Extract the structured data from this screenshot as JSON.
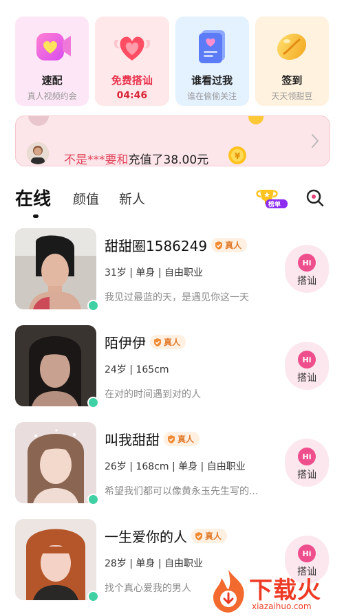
{
  "features": [
    {
      "title": "速配",
      "sub": "真人视频约会",
      "icon": "video-heart-icon"
    },
    {
      "title": "免费搭讪",
      "sub": "04:46",
      "icon": "winged-heart-icon"
    },
    {
      "title": "谁看过我",
      "sub": "谁在偷偷关注",
      "icon": "profile-card-icon"
    },
    {
      "title": "签到",
      "sub": "天天领甜豆",
      "icon": "bean-icon"
    }
  ],
  "banner": {
    "notice_user": "不是***要和",
    "notice_action": "充值了38.00元"
  },
  "tabs": {
    "online": "在线",
    "beauty": "颜值",
    "newcomer": "新人",
    "rank_label": "榜单"
  },
  "users": [
    {
      "name": "甜甜圈1586249",
      "badge": "真人",
      "info": "31岁 | 单身 | 自由职业",
      "bio": "我见过最蓝的天，是遇见你这一天",
      "greet": "搭讪",
      "hi": "Hi"
    },
    {
      "name": "陌伊伊",
      "badge": "真人",
      "info": "24岁 | 165cm",
      "bio": "在对的时间遇到对的人",
      "greet": "搭讪",
      "hi": "Hi"
    },
    {
      "name": "叫我甜甜",
      "badge": "真人",
      "info": "26岁 | 168cm | 单身 | 自由职业",
      "bio": "希望我们都可以像黄永玉先生写的...",
      "greet": "搭讪",
      "hi": "Hi"
    },
    {
      "name": "一生爱你的人",
      "badge": "真人",
      "info": "28岁 | 单身 | 自由职业",
      "bio": "找个真心爱我的男人",
      "greet": "搭讪",
      "hi": "Hi"
    }
  ],
  "watermark": {
    "brand": "下载火",
    "domain": "xiazaihuo.com"
  },
  "colors": {
    "accent": "#e8304a",
    "online": "#3fd0a4",
    "badge": "#e07a2a"
  }
}
